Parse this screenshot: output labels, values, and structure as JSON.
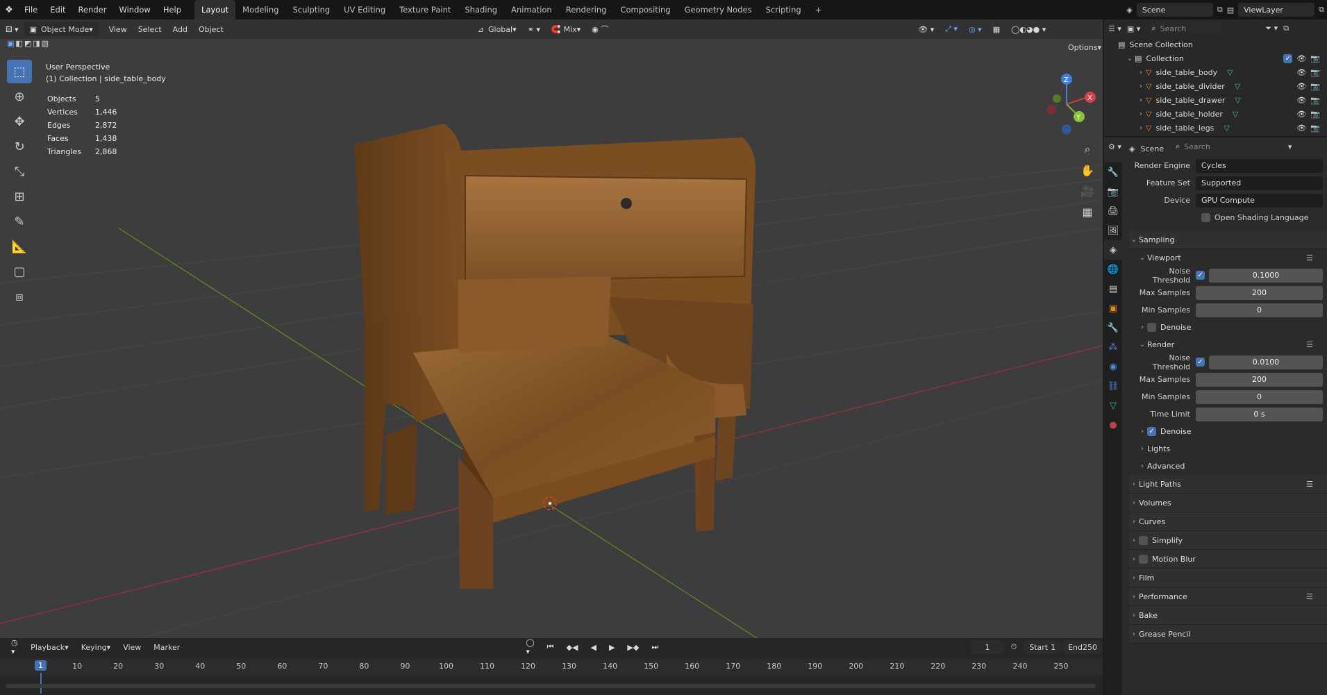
{
  "menu": [
    "File",
    "Edit",
    "Render",
    "Window",
    "Help"
  ],
  "workspaces": [
    "Layout",
    "Modeling",
    "Sculpting",
    "UV Editing",
    "Texture Paint",
    "Shading",
    "Animation",
    "Rendering",
    "Compositing",
    "Geometry Nodes",
    "Scripting"
  ],
  "active_workspace": "Layout",
  "scene": "Scene",
  "viewlayer": "ViewLayer",
  "viewport": {
    "mode": "Object Mode",
    "menus": [
      "View",
      "Select",
      "Add",
      "Object"
    ],
    "orientation": "Global",
    "snap": "Mix",
    "options": "Options",
    "perspective": "User Perspective",
    "collection_info": "(1) Collection | side_table_body",
    "stats": [
      [
        "Objects",
        "5"
      ],
      [
        "Vertices",
        "1,446"
      ],
      [
        "Edges",
        "2,872"
      ],
      [
        "Faces",
        "1,438"
      ],
      [
        "Triangles",
        "2,868"
      ]
    ]
  },
  "outliner": {
    "search": "Search",
    "scene_collection": "Scene Collection",
    "collection": "Collection",
    "objects": [
      "side_table_body",
      "side_table_divider",
      "side_table_drawer",
      "side_table_holder",
      "side_table_legs"
    ]
  },
  "properties": {
    "search": "Search",
    "context": "Scene",
    "render_engine_label": "Render Engine",
    "render_engine": "Cycles",
    "feature_set_label": "Feature Set",
    "feature_set": "Supported",
    "device_label": "Device",
    "device": "GPU Compute",
    "osl": "Open Shading Language",
    "sampling": "Sampling",
    "viewport": "Viewport",
    "render": "Render",
    "noise_threshold": "Noise Threshold",
    "max_samples": "Max Samples",
    "min_samples": "Min Samples",
    "time_limit": "Time Limit",
    "vp_noise": "0.1000",
    "vp_max": "200",
    "vp_min": "0",
    "r_noise": "0.0100",
    "r_max": "200",
    "r_min": "0",
    "r_time": "0 s",
    "denoise": "Denoise",
    "lights": "Lights",
    "advanced": "Advanced",
    "panels": [
      "Light Paths",
      "Volumes",
      "Curves",
      "Simplify",
      "Motion Blur",
      "Film",
      "Performance",
      "Bake",
      "Grease Pencil"
    ]
  },
  "timeline": {
    "menus": [
      "Playback",
      "Keying",
      "View",
      "Marker"
    ],
    "current": "1",
    "start_label": "Start",
    "start": "1",
    "end_label": "End",
    "end": "250",
    "ticks": [
      "1",
      "10",
      "20",
      "30",
      "40",
      "50",
      "60",
      "70",
      "80",
      "90",
      "100",
      "110",
      "120",
      "130",
      "140",
      "150",
      "160",
      "170",
      "180",
      "190",
      "200",
      "210",
      "220",
      "230",
      "240",
      "250"
    ]
  },
  "colors": {
    "accent": "#4772b3",
    "wood": "#8a5a2a",
    "x_axis": "#b0303c",
    "y_axis": "#6a9a2a"
  }
}
